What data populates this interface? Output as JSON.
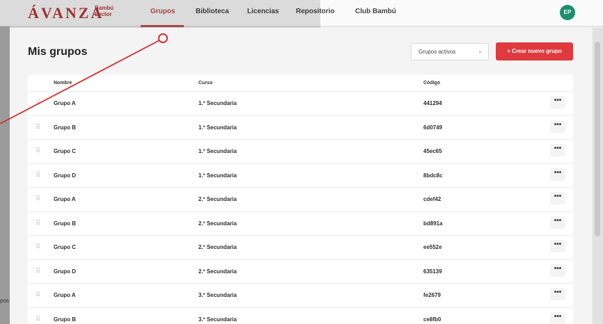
{
  "brand": {
    "logo": "ÁVANZA",
    "sub_line1": "Bambú",
    "sub_line2": "Lector"
  },
  "nav": [
    {
      "label": "Grupos",
      "active": true
    },
    {
      "label": "Biblioteca",
      "active": false
    },
    {
      "label": "Licencias",
      "active": false
    },
    {
      "label": "Repositorio",
      "active": false
    },
    {
      "label": "Club Bambú",
      "active": false
    }
  ],
  "user": {
    "initials": "EP"
  },
  "side_text": "pos",
  "page": {
    "title": "Mis grupos",
    "filter_value": "Grupos activos",
    "create_button": "+ Crear nuevo grupo"
  },
  "table": {
    "headers": {
      "name": "Nombre",
      "course": "Curso",
      "code": "Código"
    },
    "more_label": "•••",
    "rows": [
      {
        "name": "Grupo A",
        "course": "1.º Secundaria",
        "code": "441294"
      },
      {
        "name": "Grupo B",
        "course": "1.º Secundaria",
        "code": "6d0749"
      },
      {
        "name": "Grupo C",
        "course": "1.º Secundaria",
        "code": "45ec65"
      },
      {
        "name": "Grupo D",
        "course": "1.º Secundaria",
        "code": "8bdc8c"
      },
      {
        "name": "Grupo A",
        "course": "2.º Secundaria",
        "code": "cdef42"
      },
      {
        "name": "Grupo B",
        "course": "2.º Secundaria",
        "code": "bd891a"
      },
      {
        "name": "Grupo C",
        "course": "2.º Secundaria",
        "code": "ee552e"
      },
      {
        "name": "Grupo D",
        "course": "2.º Secundaria",
        "code": "635139"
      },
      {
        "name": "Grupo A",
        "course": "3.º Secundaria",
        "code": "fe2679"
      },
      {
        "name": "Grupo B",
        "course": "3.º Secundaria",
        "code": "ce8fb0"
      }
    ]
  },
  "colors": {
    "brand": "#b33a3a",
    "accent": "#e0393e",
    "active_nav": "#c0504d",
    "avatar": "#1a8f6e",
    "annotation": "#d32f2f"
  }
}
